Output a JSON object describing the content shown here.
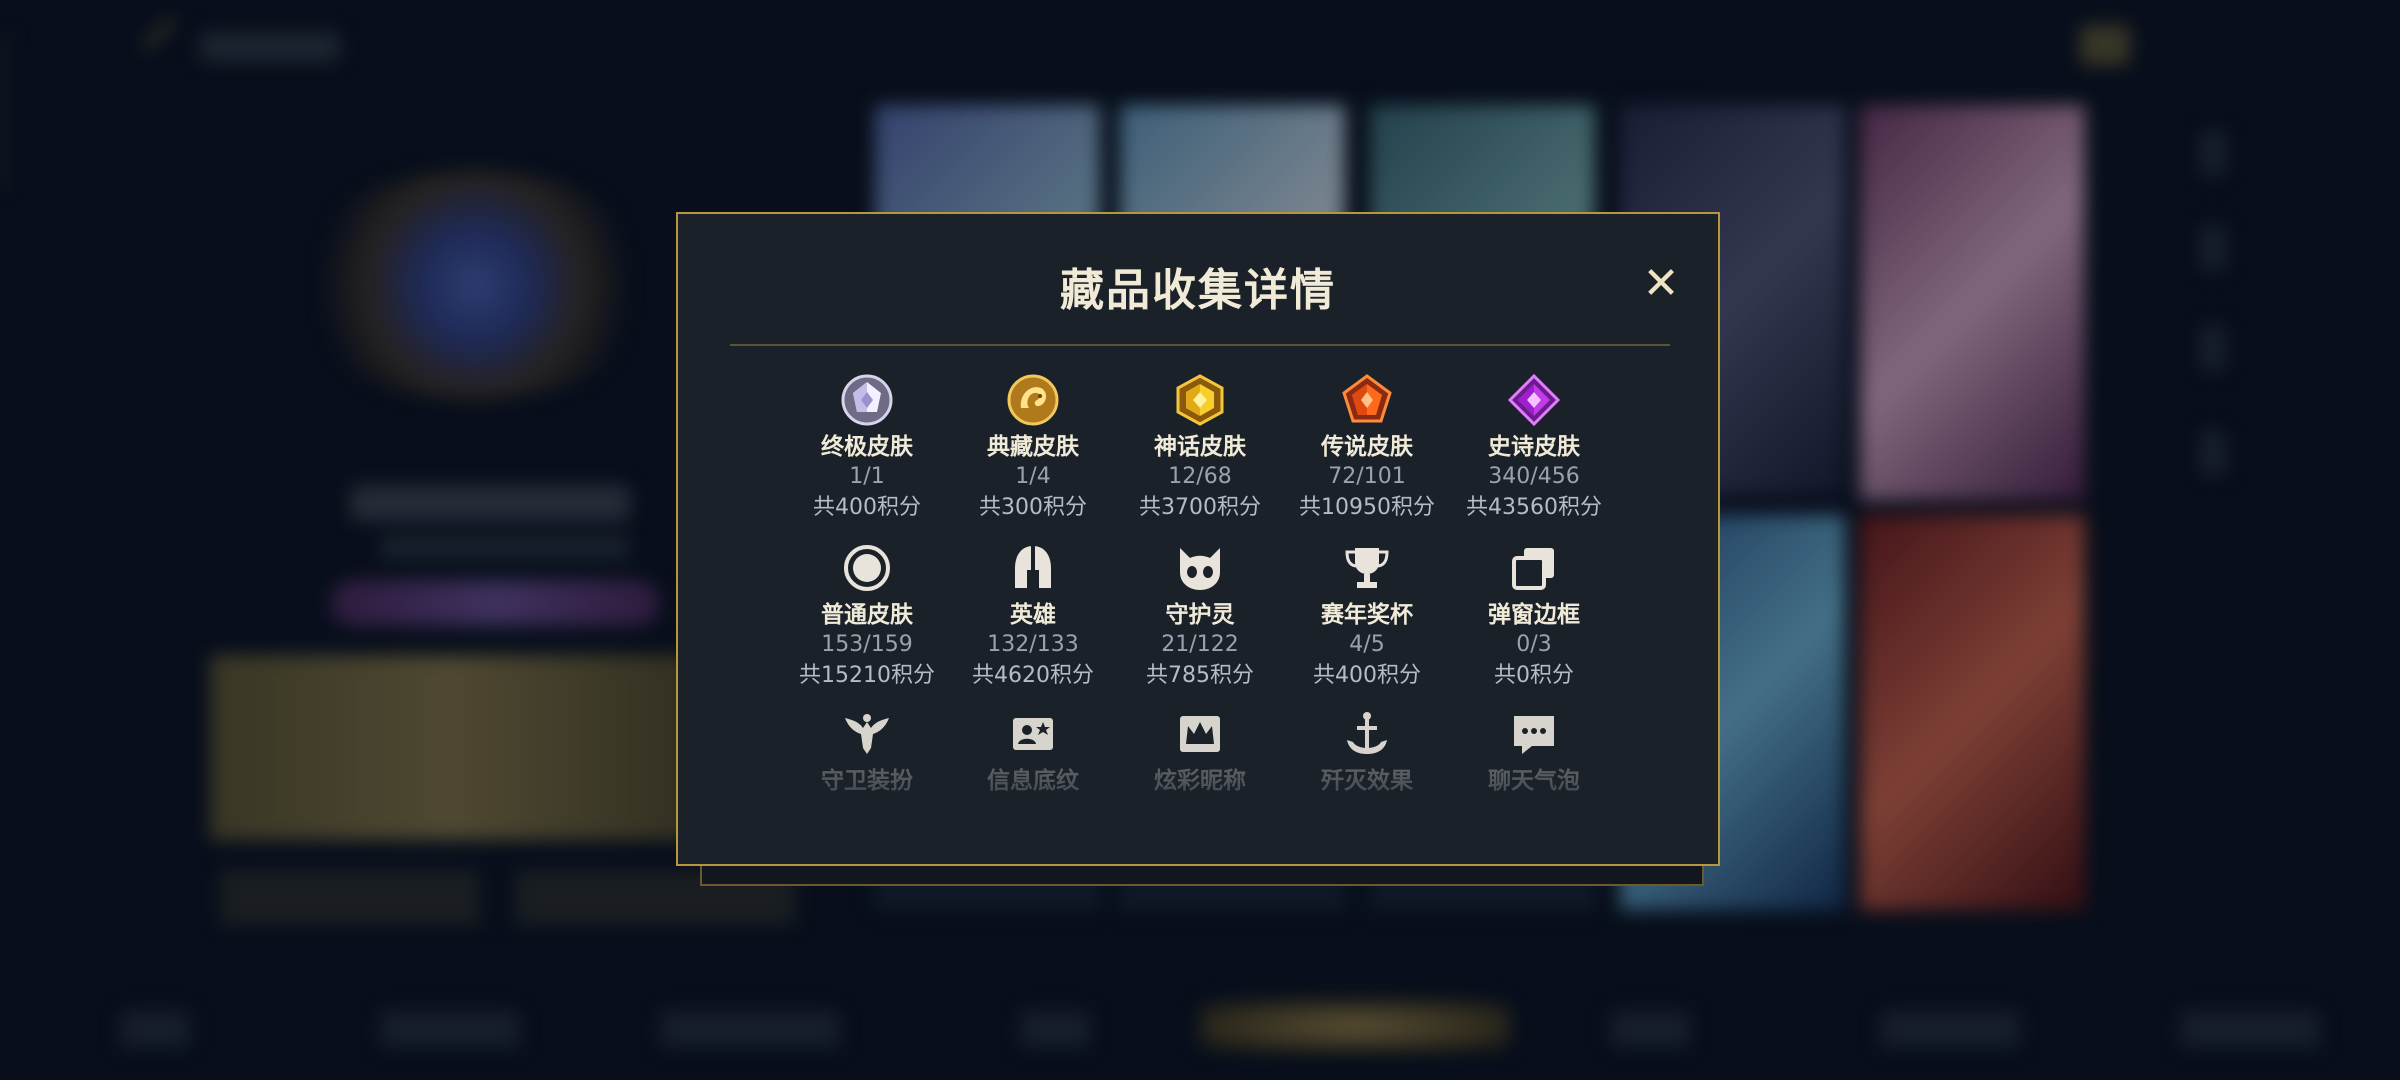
{
  "dialog": {
    "title": "藏品收集详情",
    "close_label": "✕"
  },
  "rows": [
    [
      {
        "label": "终极皮肤",
        "count": "1/1",
        "score": "共400积分",
        "icon": "ultimate-skin-gem-icon"
      },
      {
        "label": "典藏皮肤",
        "count": "1/4",
        "score": "共300积分",
        "icon": "collector-skin-dragon-icon"
      },
      {
        "label": "神话皮肤",
        "count": "12/68",
        "score": "共3700积分",
        "icon": "mythic-skin-gem-icon"
      },
      {
        "label": "传说皮肤",
        "count": "72/101",
        "score": "共10950积分",
        "icon": "legendary-skin-gem-icon"
      },
      {
        "label": "史诗皮肤",
        "count": "340/456",
        "score": "共43560积分",
        "icon": "epic-skin-gem-icon"
      }
    ],
    [
      {
        "label": "普通皮肤",
        "count": "153/159",
        "score": "共15210积分",
        "icon": "normal-skin-ring-icon"
      },
      {
        "label": "英雄",
        "count": "132/133",
        "score": "共4620积分",
        "icon": "hero-helmet-icon"
      },
      {
        "label": "守护灵",
        "count": "21/122",
        "score": "共785积分",
        "icon": "guardian-spirit-icon"
      },
      {
        "label": "赛年奖杯",
        "count": "4/5",
        "score": "共400积分",
        "icon": "season-trophy-icon"
      },
      {
        "label": "弹窗边框",
        "count": "0/3",
        "score": "共0积分",
        "icon": "popup-frame-icon"
      }
    ],
    [
      {
        "label": "守卫装扮",
        "icon": "ward-skin-icon"
      },
      {
        "label": "信息底纹",
        "icon": "info-card-icon"
      },
      {
        "label": "炫彩昵称",
        "icon": "colorful-nickname-crown-icon"
      },
      {
        "label": "歼灭效果",
        "icon": "elimination-effect-anchor-icon"
      },
      {
        "label": "聊天气泡",
        "icon": "chat-bubble-icon"
      }
    ]
  ],
  "colors": {
    "accent_gold": "#b8963e",
    "dialog_bg": "#1b2129",
    "label_text": "#f0ead8",
    "muted_text": "#9aa3ad"
  }
}
